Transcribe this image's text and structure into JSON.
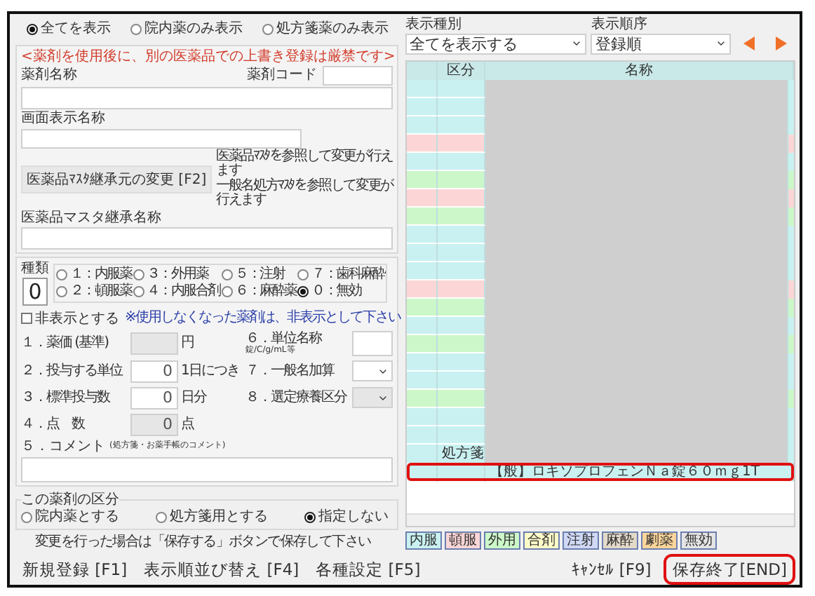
{
  "filter_radios": [
    {
      "label": "全てを表示",
      "selected": true
    },
    {
      "label": "院内薬のみ表示",
      "selected": false
    },
    {
      "label": "処方箋薬のみ表示",
      "selected": false
    }
  ],
  "notice": "<薬剤を使用後に、別の医薬品での上書き登録は厳禁です>",
  "drug_name": {
    "label": "薬剤名称"
  },
  "drug_code": {
    "label": "薬剤コード"
  },
  "display_name": {
    "label": "画面表示名称"
  },
  "master_button": {
    "label": "医薬品ﾏｽﾀ継承元の変更 [F2]",
    "notes": [
      "医薬品ﾏｽﾀを参照して変更が行えます",
      "一般名処方ﾏｽﾀを参照して変更が行えます"
    ]
  },
  "master_name": {
    "label": "医薬品マスタ継承名称"
  },
  "kind": {
    "label": "種類",
    "value": "0",
    "options": [
      {
        "label": "１：内服薬",
        "selected": false
      },
      {
        "label": "３：外用薬",
        "selected": false
      },
      {
        "label": "５：注射",
        "selected": false
      },
      {
        "label": "７：歯科麻酔",
        "selected": false
      },
      {
        "label": "２：頓服薬",
        "selected": false
      },
      {
        "label": "４：内服合剤",
        "selected": false
      },
      {
        "label": "６：麻酔薬",
        "selected": false
      },
      {
        "label": "０：無効",
        "selected": true
      }
    ]
  },
  "hidden_checkbox": {
    "label": "非表示とする",
    "checked": false,
    "note": "※使用しなくなった薬剤は、非表示として下さい"
  },
  "fields_left": [
    {
      "label": "１．薬価 (基準)",
      "unit": "円",
      "disabled": true
    },
    {
      "label": "２．投与する単位",
      "value": "0",
      "unit": "1日につき",
      "disabled": false
    },
    {
      "label": "３．標準投与数",
      "value": "0",
      "unit": "日分",
      "disabled": false
    },
    {
      "label": "４．点　数",
      "value": "0",
      "unit": "点",
      "disabled": true
    }
  ],
  "fields_right": [
    {
      "kind": "input",
      "label": "６．単位名称",
      "sublabel": "錠/C/g/mL等",
      "disabled": false
    },
    {
      "kind": "select",
      "label": "７．一般名加算",
      "disabled": false
    },
    {
      "kind": "select",
      "label": "８．選定療養区分",
      "disabled": true
    }
  ],
  "comment": {
    "label": "５．コメント",
    "sublabel": "(処方箋・お薬手帳のコメント)"
  },
  "category": {
    "title": "この薬剤の区分",
    "options": [
      {
        "label": "院内薬とする",
        "selected": false
      },
      {
        "label": "処方箋用とする",
        "selected": false
      },
      {
        "label": "指定しない",
        "selected": true
      }
    ]
  },
  "save_note": "変更を行った場合は「保存する」ボタンで保存して下さい",
  "left_buttons": [
    "新規登録 [F1]",
    "表示順並び替え [F4]",
    "各種設定 [F5]"
  ],
  "display_type": {
    "label": "表示種別",
    "value": "全てを表示する"
  },
  "display_order": {
    "label": "表示順序",
    "value": "登録順"
  },
  "table": {
    "columns": [
      "区分",
      "名称"
    ],
    "rows": [
      {
        "color": "#c9f1f1",
        "selected": false
      },
      {
        "color": "#c9f1f1",
        "selected": false
      },
      {
        "color": "#c9f1f1",
        "selected": false
      },
      {
        "color": "#fcd6d6",
        "selected": false
      },
      {
        "color": "#c9f1f1",
        "selected": false
      },
      {
        "color": "#ccf7c8",
        "selected": false
      },
      {
        "color": "#fcd6d6",
        "selected": false
      },
      {
        "color": "#ccf7c8",
        "selected": false
      },
      {
        "color": "#c9f1f1",
        "selected": false
      },
      {
        "color": "#c9f1f1",
        "selected": false
      },
      {
        "color": "#c9f1f1",
        "selected": false
      },
      {
        "color": "#fcd6d6",
        "selected": false
      },
      {
        "color": "#ccf7c8",
        "selected": false
      },
      {
        "color": "#c9f1f1",
        "selected": false
      },
      {
        "color": "#ccf7c8",
        "selected": false
      },
      {
        "color": "#c9f1f1",
        "selected": false
      },
      {
        "color": "#c9f1f1",
        "selected": false
      },
      {
        "color": "#ccf7c8",
        "selected": false
      },
      {
        "color": "#c9f1f1",
        "selected": false
      },
      {
        "color": "#c9f1f1",
        "selected": false
      },
      {
        "color": "#c9f1f1",
        "selected": false,
        "kubun": "処方箋"
      },
      {
        "color": "#c9f1f1",
        "selected": true,
        "name": "【般】ロキソプロフェンＮａ錠６０ｍｇ1T"
      }
    ]
  },
  "legend": [
    {
      "label": "内服",
      "color": "#c9f1f1"
    },
    {
      "label": "頓服",
      "color": "#fcd6d6"
    },
    {
      "label": "外用",
      "color": "#ccf7c8"
    },
    {
      "label": "合剤",
      "color": "#fdfbc8"
    },
    {
      "label": "注射",
      "color": "#cfd8f5"
    },
    {
      "label": "麻酔",
      "color": "#e3d9c9"
    },
    {
      "label": "劇薬",
      "color": "#fbd59a"
    },
    {
      "label": "無効",
      "color": "#e4e4e4"
    }
  ],
  "right_buttons": [
    {
      "label": "ｷｬﾝｾﾙ [F9]",
      "highlighted": false
    },
    {
      "label": "保存終了[END]",
      "highlighted": true
    }
  ]
}
